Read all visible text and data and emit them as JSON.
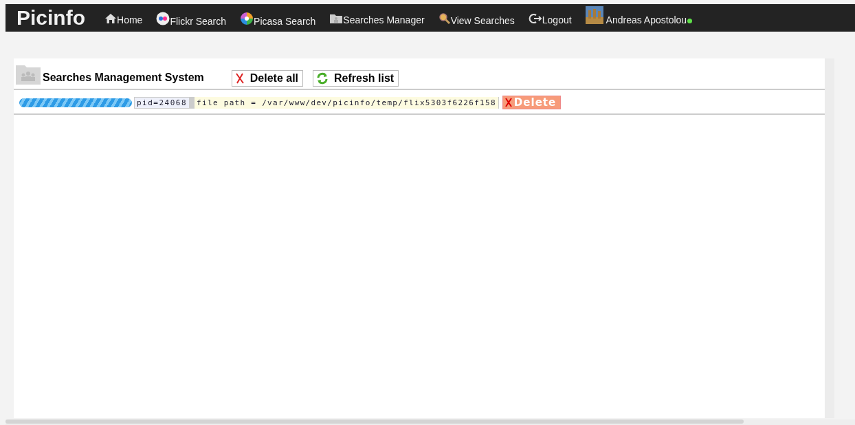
{
  "brand": "Picinfo",
  "nav": [
    {
      "label": "Home",
      "kind": "home"
    },
    {
      "label": "Flickr Search",
      "kind": "flickr"
    },
    {
      "label": "Picasa Search",
      "kind": "picasa"
    },
    {
      "label": "Searches Manager",
      "kind": "folder"
    },
    {
      "label": "View Searches",
      "kind": "magnifier"
    },
    {
      "label": "Logout",
      "kind": "logout"
    }
  ],
  "user": {
    "name": "Andreas Apostolou",
    "online": true
  },
  "panel": {
    "title": "Searches Management System",
    "buttons": [
      {
        "label": "Delete all",
        "kind": "delete"
      },
      {
        "label": "Refresh list",
        "kind": "refresh"
      }
    ]
  },
  "processes": [
    {
      "level": 1,
      "pid": "pid=24068",
      "path": "file path = /var/www/dev/picinfo/temp/flix5303f6226f158",
      "action": "Delete"
    }
  ]
}
